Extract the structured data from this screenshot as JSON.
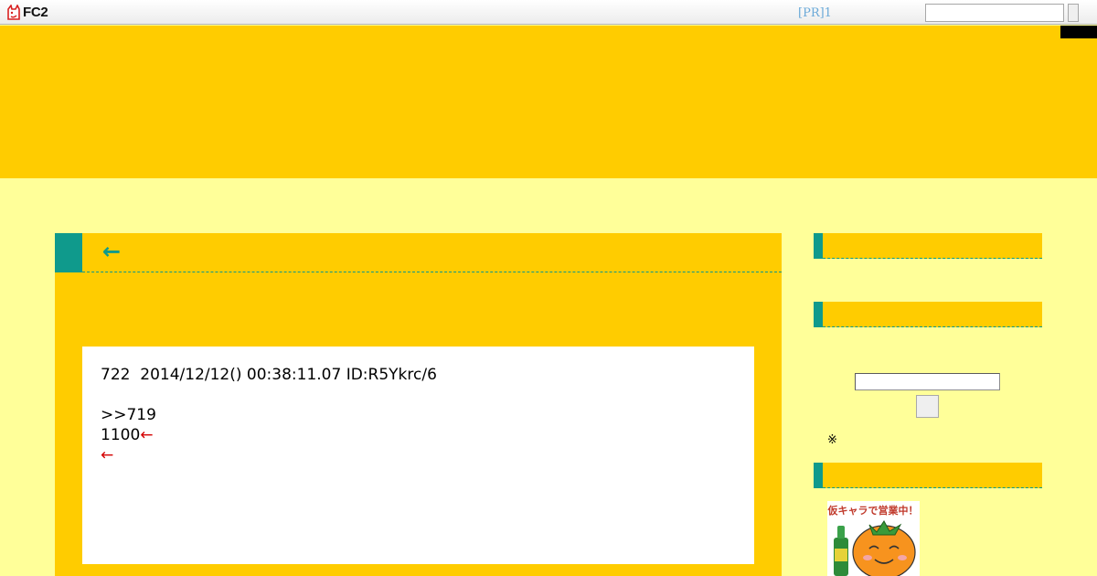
{
  "topbar": {
    "logo_text": "FC2",
    "pr_link": "[PR]1",
    "search_value": ""
  },
  "article": {
    "title": "←",
    "post": {
      "header_line": "722  2014/12/12() 00:38:11.07 ID:R5Ykrc/6",
      "reply_ref": ">>719",
      "line2_text": "1100",
      "line2_arrow": "←",
      "line3_arrow": "←"
    }
  },
  "sidebar": {
    "search_value": "",
    "note": "※",
    "banner": {
      "caption": "仮キャラで営業中！",
      "icon": "orange-mascot-icon"
    }
  },
  "colors": {
    "accent": "#0f9a8c",
    "header": "#ffcc00",
    "background": "#ffff99",
    "arrow_red": "#d40000"
  }
}
